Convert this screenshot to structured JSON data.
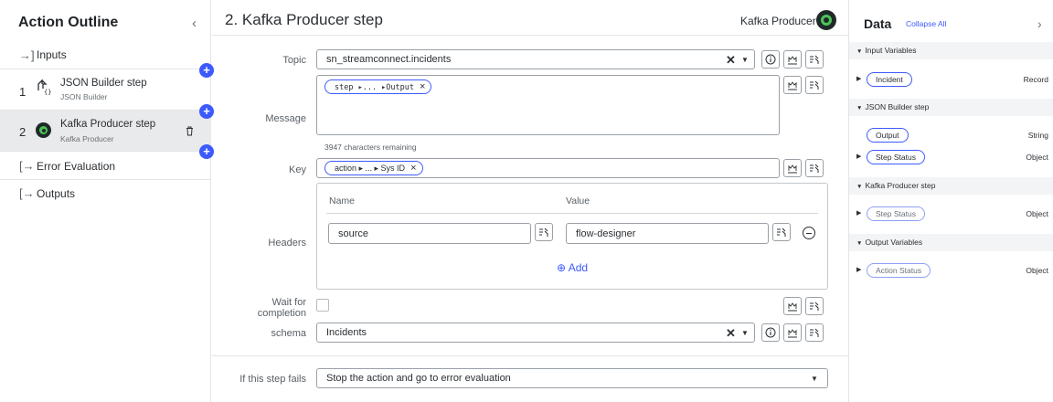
{
  "outline": {
    "title": "Action Outline",
    "collapse_glyph": "‹",
    "inputs_label": "Inputs",
    "steps": [
      {
        "number": "1",
        "title": "JSON Builder step",
        "subtitle": "JSON Builder"
      },
      {
        "number": "2",
        "title": "Kafka Producer step",
        "subtitle": "Kafka Producer"
      }
    ],
    "error_label": "Error Evaluation",
    "outputs_label": "Outputs"
  },
  "step": {
    "header": "2.  Kafka Producer step",
    "type_label": "Kafka Producer"
  },
  "form": {
    "topic_label": "Topic",
    "topic_value": "sn_streamconnect.incidents",
    "message_label": "Message",
    "message_pill": "step ▸... ▸Output",
    "remaining": "3947 characters remaining",
    "key_label": "Key",
    "key_pill": "action ▸ ... ▸ Sys ID",
    "headers_label": "Headers",
    "headers_name_col": "Name",
    "headers_value_col": "Value",
    "header_name_value": "source",
    "header_value_value": "flow-designer",
    "add_label": "⊕ Add",
    "wait_label_1": "Wait for",
    "wait_label_2": "completion",
    "schema_label": "schema",
    "schema_value": "Incidents",
    "fail_label": "If this step fails",
    "fail_value": "Stop the action and go to error evaluation"
  },
  "data_pane": {
    "title": "Data",
    "collapse_all": "Collapse All",
    "chevron": "›",
    "sections": [
      {
        "title": "Input Variables",
        "rows": [
          {
            "pill": "Incident",
            "type": "Record"
          }
        ]
      },
      {
        "title": "JSON Builder step",
        "rows": [
          {
            "pill": "Output",
            "type": "String"
          },
          {
            "pill": "Step Status",
            "type": "Object"
          }
        ]
      },
      {
        "title": "Kafka Producer step",
        "rows": [
          {
            "pill": "Step Status",
            "type": "Object"
          }
        ]
      },
      {
        "title": "Output Variables",
        "rows": [
          {
            "pill": "Action Status",
            "type": "Object"
          }
        ]
      }
    ]
  },
  "colors": {
    "accent": "#3d5afe",
    "kafka_green": "#4fc35a"
  }
}
